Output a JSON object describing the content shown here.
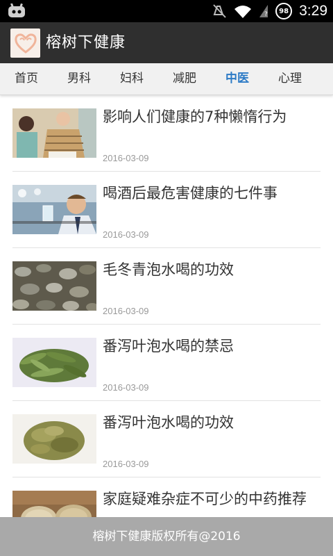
{
  "status_bar": {
    "time": "3:29",
    "battery_level": "98",
    "icons": [
      "android-icon",
      "mute-icon",
      "wifi-icon",
      "signal-icon",
      "battery-icon"
    ]
  },
  "app_bar": {
    "title": "榕树下健康",
    "logo_icon": "heart-hands-logo"
  },
  "tabs": [
    {
      "label": "首页",
      "active": false
    },
    {
      "label": "男科",
      "active": false
    },
    {
      "label": "妇科",
      "active": false
    },
    {
      "label": "减肥",
      "active": false
    },
    {
      "label": "中医",
      "active": true
    },
    {
      "label": "心理",
      "active": false
    }
  ],
  "articles": [
    {
      "title": "影响人们健康的7种懒惰行为",
      "date": "2016-03-09",
      "thumb": "elderly-people-photo"
    },
    {
      "title": "喝酒后最危害健康的七件事",
      "date": "2016-03-09",
      "thumb": "man-drinking-photo"
    },
    {
      "title": "毛冬青泡水喝的功效",
      "date": "2016-03-09",
      "thumb": "dried-herb-slices-photo"
    },
    {
      "title": "番泻叶泡水喝的禁忌",
      "date": "2016-03-09",
      "thumb": "senna-leaves-photo"
    },
    {
      "title": "番泻叶泡水喝的功效",
      "date": "2016-03-09",
      "thumb": "senna-leaves-pile-photo"
    },
    {
      "title": "家庭疑难杂症不可少的中药推荐",
      "date": "",
      "thumb": "herbal-grains-photo"
    }
  ],
  "footer": {
    "text": "榕树下健康版权所有@2016"
  },
  "colors": {
    "accent": "#2d7bc6",
    "app_bar": "#2f2f2f",
    "tab_bar": "#f1f1f1",
    "footer": "#a9a9a9"
  }
}
